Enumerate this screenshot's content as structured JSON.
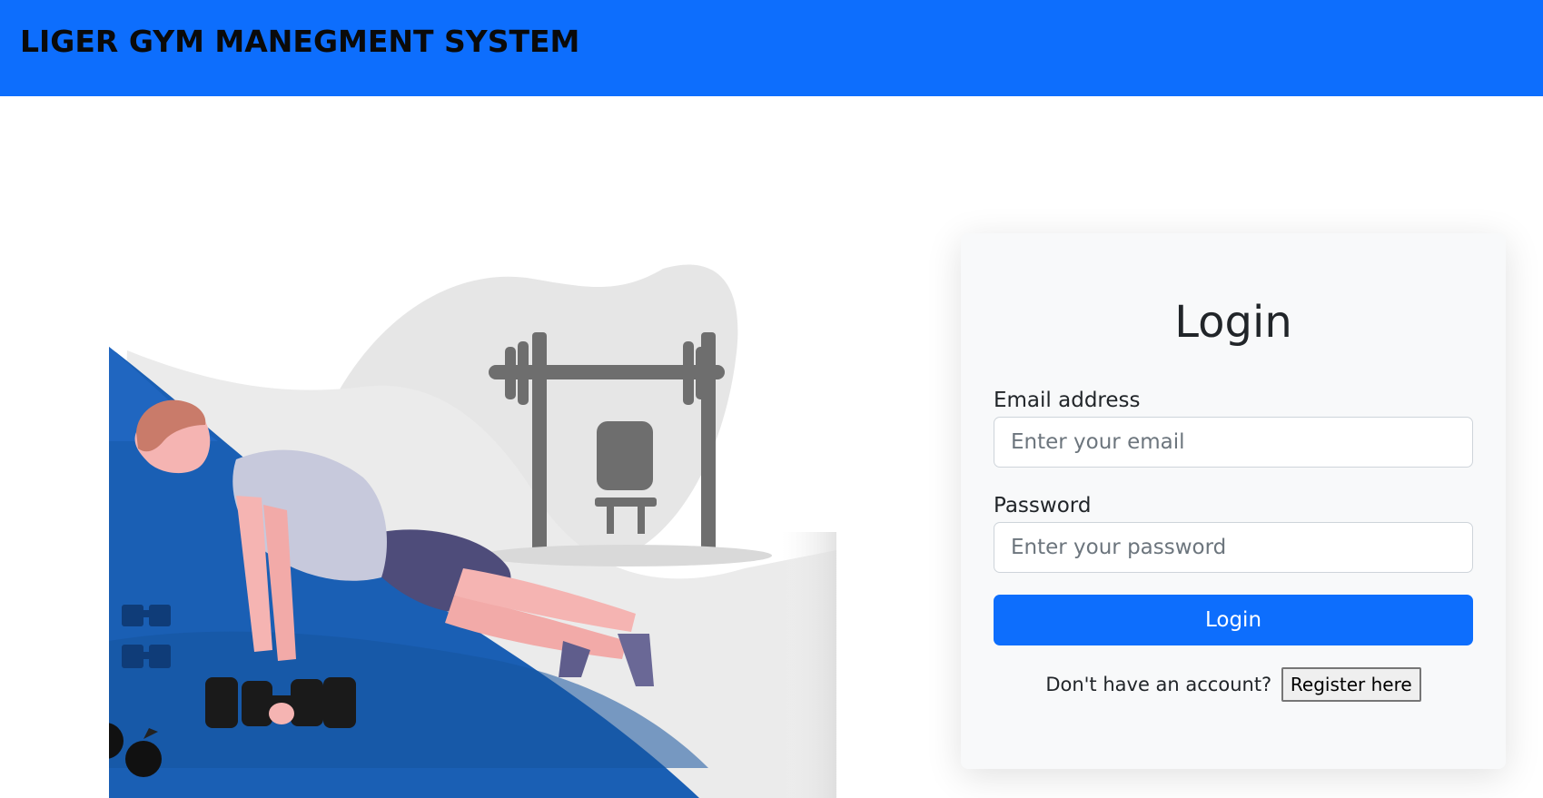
{
  "header": {
    "brand": "LIGER GYM MANEGMENT SYSTEM"
  },
  "login": {
    "title": "Login",
    "email_label": "Email address",
    "email_placeholder": "Enter your email",
    "email_value": "",
    "password_label": "Password",
    "password_placeholder": "Enter your password",
    "password_value": "",
    "submit_label": "Login",
    "register_prompt": "Don't have an account?",
    "register_label": "Register here"
  },
  "colors": {
    "primary": "#0d6efd",
    "card_bg": "#f8f9fa",
    "illustration_blue": "#1a5fb4",
    "equipment_gray": "#6e6e6e"
  },
  "illustration": {
    "subject": "person doing push-ups on dumbbells with gym bench and barbell rack"
  }
}
